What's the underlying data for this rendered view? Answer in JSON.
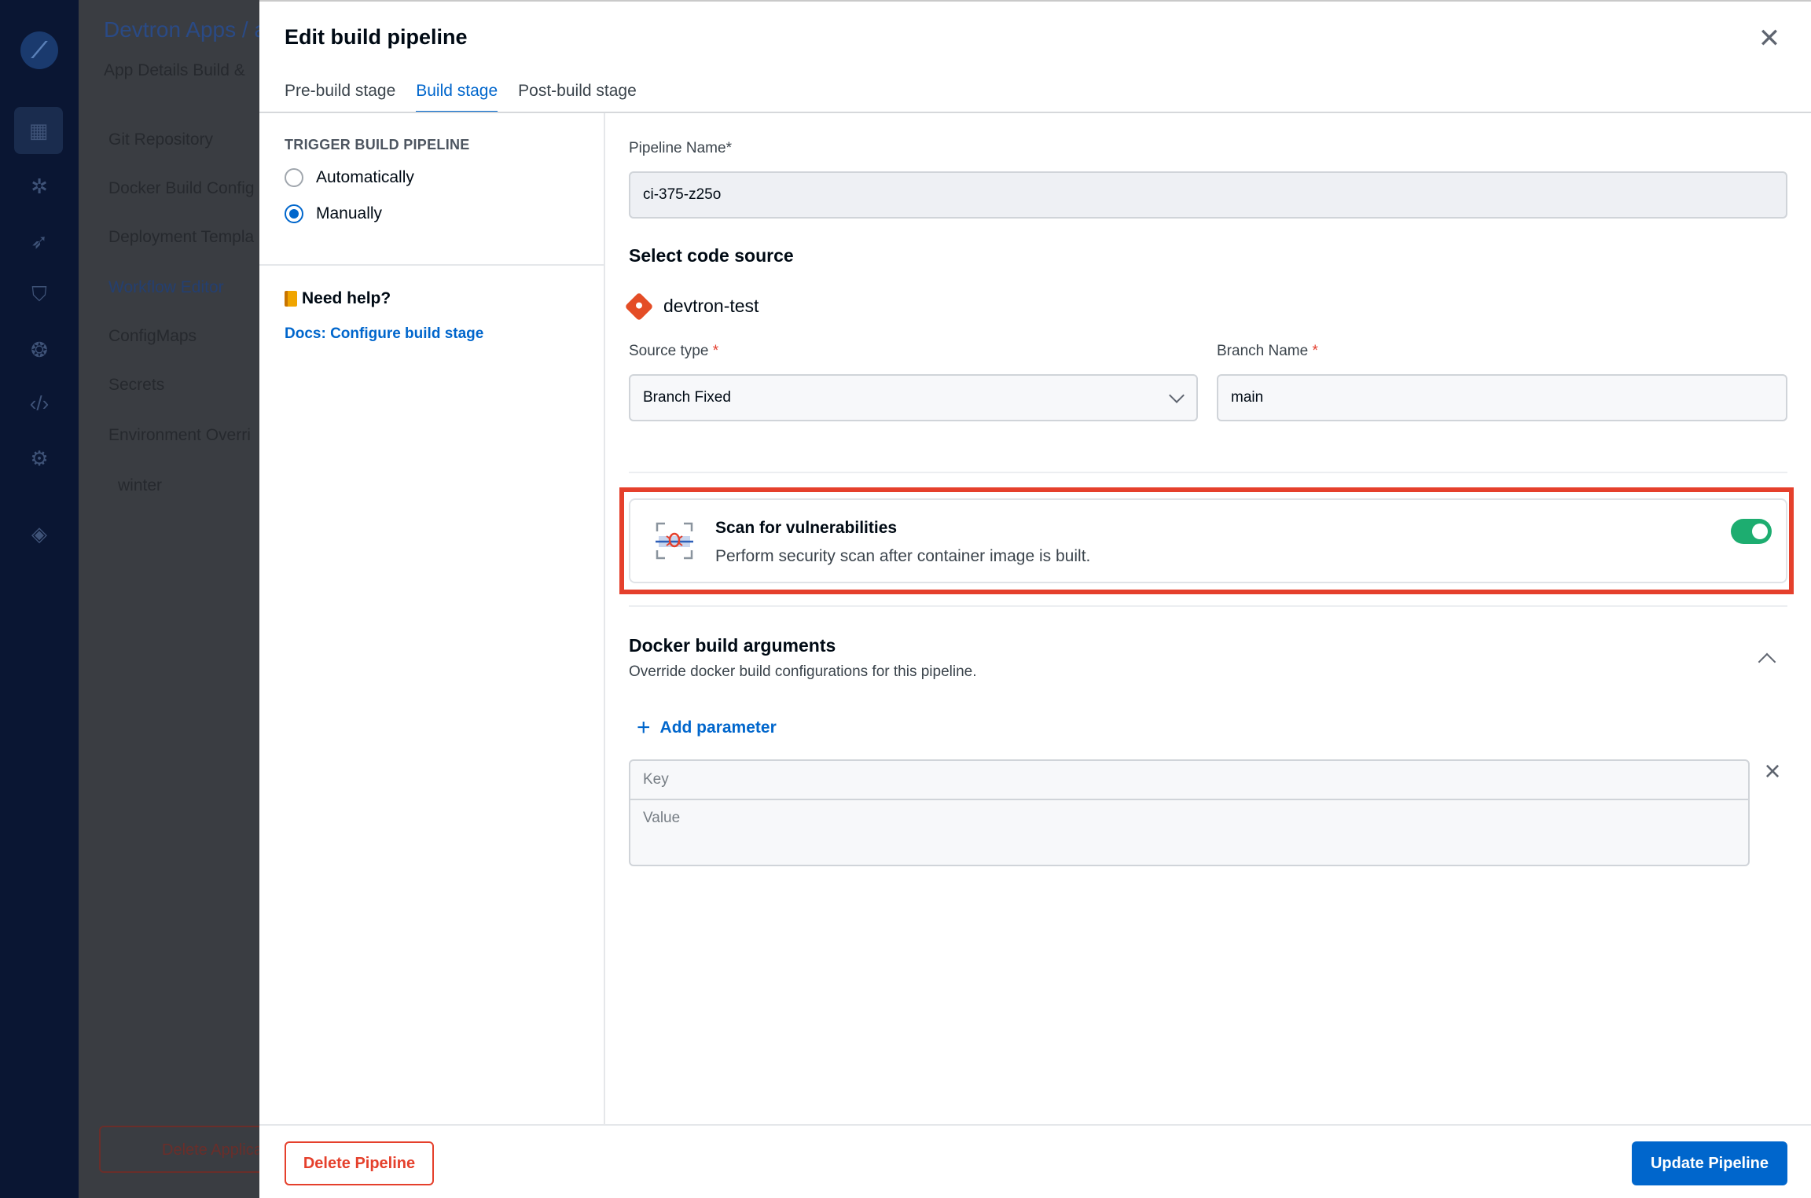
{
  "background": {
    "breadcrumb": "Devtron Apps /  a",
    "tabs": "App Details    Build &",
    "nav": [
      "Git Repository",
      "Docker Build Config",
      "Deployment Templa",
      "Workflow Editor",
      "ConfigMaps",
      "Secrets",
      "Environment Overri",
      "winter"
    ],
    "delete_app": "Delete Applica"
  },
  "modal": {
    "title": "Edit build pipeline",
    "tabs": [
      {
        "label": "Pre-build stage",
        "active": false
      },
      {
        "label": "Build stage",
        "active": true
      },
      {
        "label": "Post-build stage",
        "active": false
      }
    ]
  },
  "trigger": {
    "heading": "TRIGGER BUILD PIPELINE",
    "options": [
      {
        "label": "Automatically",
        "selected": false
      },
      {
        "label": "Manually",
        "selected": true
      }
    ]
  },
  "help": {
    "title": "Need help?",
    "link": "Docs: Configure build stage"
  },
  "pipeline": {
    "name_label": "Pipeline Name*",
    "name_value": "ci-375-z25o"
  },
  "code_source": {
    "heading": "Select code source",
    "repo": "devtron-test",
    "source_type_label": "Source type",
    "source_type_value": "Branch Fixed",
    "branch_label": "Branch Name",
    "branch_value": "main",
    "required_mark": "*"
  },
  "scan": {
    "title": "Scan for vulnerabilities",
    "description": "Perform security scan after container image is built.",
    "enabled": true
  },
  "docker_args": {
    "heading": "Docker build arguments",
    "description": "Override docker build configurations for this pipeline.",
    "add_label": "Add parameter",
    "key_placeholder": "Key",
    "value_placeholder": "Value"
  },
  "footer": {
    "delete_label": "Delete Pipeline",
    "update_label": "Update Pipeline"
  },
  "colors": {
    "accent": "#0066cc",
    "danger": "#e5402c",
    "toggle_on": "#1dad70"
  },
  "icons": [
    "close-icon",
    "book-icon",
    "git-icon",
    "chevron-down-icon",
    "scan-bug-icon",
    "chevron-up-icon",
    "plus-icon",
    "remove-icon"
  ]
}
